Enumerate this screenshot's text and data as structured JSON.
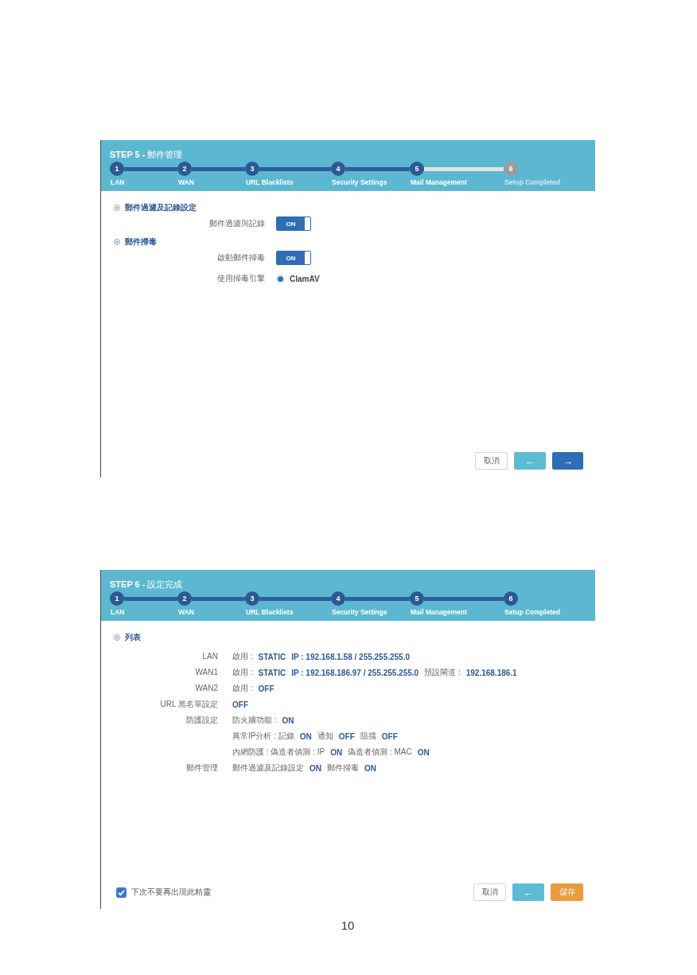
{
  "screens": [
    {
      "title": "**STEP 5 -** 郵件管理",
      "steps": [
        {
          "number": "1",
          "label": "LAN",
          "reached": true
        },
        {
          "number": "2",
          "label": "WAN",
          "reached": true
        },
        {
          "number": "3",
          "label": "URL Blacklists",
          "reached": true
        },
        {
          "number": "4",
          "label": "Security Settings",
          "reached": true
        },
        {
          "number": "5",
          "label": "Mail Management",
          "reached": true
        },
        {
          "number": "6",
          "label": "Setup Completed",
          "reached": false
        }
      ],
      "sections": [
        {
          "title": "郵件過濾及記錄設定",
          "rows": [
            {
              "kind": "toggle",
              "label": "郵件過濾與記錄",
              "text": "ON",
              "on": true
            }
          ]
        },
        {
          "title": "郵件掃毒",
          "rows": [
            {
              "kind": "toggle",
              "label": "啟動郵件掃毒",
              "text": "ON",
              "on": true
            },
            {
              "kind": "radio",
              "label": "使用掃毒引擎",
              "option": "ClamAV",
              "selected": true
            }
          ]
        }
      ],
      "footer": {
        "buttons": [
          {
            "kind": "cancel",
            "label": "取消"
          },
          {
            "kind": "back",
            "label": "←"
          },
          {
            "kind": "next",
            "label": "→"
          }
        ]
      }
    },
    {
      "title": "**STEP 6 -** 設定完成",
      "steps": [
        {
          "number": "1",
          "label": "LAN",
          "reached": true
        },
        {
          "number": "2",
          "label": "WAN",
          "reached": true
        },
        {
          "number": "3",
          "label": "URL Blacklists",
          "reached": true
        },
        {
          "number": "4",
          "label": "Security Settings",
          "reached": true
        },
        {
          "number": "5",
          "label": "Mail Management",
          "reached": true
        },
        {
          "number": "6",
          "label": "Setup Completed",
          "reached": true
        }
      ],
      "sections": [
        {
          "title": "列表",
          "rows": [
            {
              "kind": "summary",
              "label": "LAN",
              "lines": [
                [
                  {
                    "kind": "name",
                    "text": "啟用 :"
                  },
                  {
                    "kind": "value",
                    "text": "STATIC"
                  },
                  {
                    "kind": "value",
                    "text": "IP : 192.168.1.58 / 255.255.255.0"
                  }
                ]
              ]
            },
            {
              "kind": "summary",
              "label": "WAN1",
              "lines": [
                [
                  {
                    "kind": "name",
                    "text": "啟用 :"
                  },
                  {
                    "kind": "value",
                    "text": "STATIC"
                  },
                  {
                    "kind": "value",
                    "text": "IP : 192.168.186.97 / 255.255.255.0"
                  },
                  {
                    "kind": "name",
                    "text": "預設閘道 :"
                  },
                  {
                    "kind": "value",
                    "text": "192.168.186.1"
                  }
                ]
              ]
            },
            {
              "kind": "summary",
              "label": "WAN2",
              "lines": [
                [
                  {
                    "kind": "name",
                    "text": "啟用 :"
                  },
                  {
                    "kind": "value",
                    "text": "OFF"
                  }
                ]
              ]
            },
            {
              "kind": "summary",
              "label": "URL 黑名單設定",
              "lines": [
                [
                  {
                    "kind": "value",
                    "text": "OFF"
                  }
                ]
              ]
            },
            {
              "kind": "summary",
              "label": "防護設定",
              "lines": [
                [
                  {
                    "kind": "name",
                    "text": "防火牆功能 :"
                  },
                  {
                    "kind": "value",
                    "text": "ON"
                  }
                ],
                [
                  {
                    "kind": "name",
                    "text": "異常IP分析 : 記錄"
                  },
                  {
                    "kind": "value",
                    "text": "ON"
                  },
                  {
                    "kind": "name",
                    "text": "通知"
                  },
                  {
                    "kind": "value",
                    "text": "OFF"
                  },
                  {
                    "kind": "name",
                    "text": "阻擋"
                  },
                  {
                    "kind": "value",
                    "text": "OFF"
                  }
                ],
                [
                  {
                    "kind": "name",
                    "text": "內網防護 : 偽造者偵測 : IP"
                  },
                  {
                    "kind": "value",
                    "text": "ON"
                  },
                  {
                    "kind": "name",
                    "text": "偽造者偵測 : MAC"
                  },
                  {
                    "kind": "value",
                    "text": "ON"
                  }
                ]
              ]
            },
            {
              "kind": "summary",
              "label": "郵件管理",
              "lines": [
                [
                  {
                    "kind": "name",
                    "text": "郵件過濾及記錄設定"
                  },
                  {
                    "kind": "value",
                    "text": "ON"
                  },
                  {
                    "kind": "name",
                    "text": "郵件掃毒"
                  },
                  {
                    "kind": "value",
                    "text": "ON"
                  }
                ]
              ]
            }
          ]
        }
      ],
      "footer": {
        "checkbox": {
          "label": "下次不要再出現此精靈",
          "checked": true
        },
        "buttons": [
          {
            "kind": "cancel",
            "label": "取消"
          },
          {
            "kind": "back",
            "label": "←"
          },
          {
            "kind": "save",
            "label": "儲存"
          }
        ]
      }
    }
  ],
  "page_number": "10"
}
